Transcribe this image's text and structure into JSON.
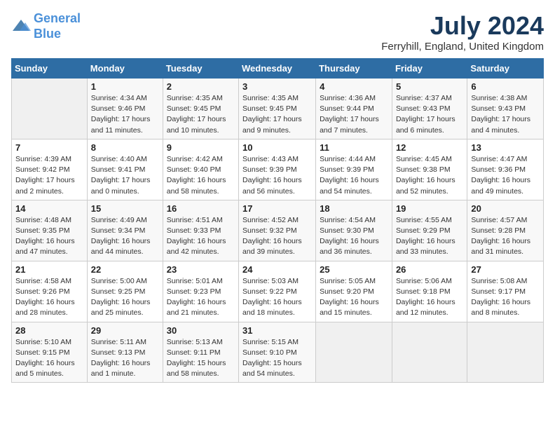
{
  "header": {
    "logo_line1": "General",
    "logo_line2": "Blue",
    "month_title": "July 2024",
    "location": "Ferryhill, England, United Kingdom"
  },
  "weekdays": [
    "Sunday",
    "Monday",
    "Tuesday",
    "Wednesday",
    "Thursday",
    "Friday",
    "Saturday"
  ],
  "weeks": [
    [
      {
        "day": "",
        "empty": true
      },
      {
        "day": "1",
        "sunrise": "Sunrise: 4:34 AM",
        "sunset": "Sunset: 9:46 PM",
        "daylight": "Daylight: 17 hours and 11 minutes."
      },
      {
        "day": "2",
        "sunrise": "Sunrise: 4:35 AM",
        "sunset": "Sunset: 9:45 PM",
        "daylight": "Daylight: 17 hours and 10 minutes."
      },
      {
        "day": "3",
        "sunrise": "Sunrise: 4:35 AM",
        "sunset": "Sunset: 9:45 PM",
        "daylight": "Daylight: 17 hours and 9 minutes."
      },
      {
        "day": "4",
        "sunrise": "Sunrise: 4:36 AM",
        "sunset": "Sunset: 9:44 PM",
        "daylight": "Daylight: 17 hours and 7 minutes."
      },
      {
        "day": "5",
        "sunrise": "Sunrise: 4:37 AM",
        "sunset": "Sunset: 9:43 PM",
        "daylight": "Daylight: 17 hours and 6 minutes."
      },
      {
        "day": "6",
        "sunrise": "Sunrise: 4:38 AM",
        "sunset": "Sunset: 9:43 PM",
        "daylight": "Daylight: 17 hours and 4 minutes."
      }
    ],
    [
      {
        "day": "7",
        "sunrise": "Sunrise: 4:39 AM",
        "sunset": "Sunset: 9:42 PM",
        "daylight": "Daylight: 17 hours and 2 minutes."
      },
      {
        "day": "8",
        "sunrise": "Sunrise: 4:40 AM",
        "sunset": "Sunset: 9:41 PM",
        "daylight": "Daylight: 17 hours and 0 minutes."
      },
      {
        "day": "9",
        "sunrise": "Sunrise: 4:42 AM",
        "sunset": "Sunset: 9:40 PM",
        "daylight": "Daylight: 16 hours and 58 minutes."
      },
      {
        "day": "10",
        "sunrise": "Sunrise: 4:43 AM",
        "sunset": "Sunset: 9:39 PM",
        "daylight": "Daylight: 16 hours and 56 minutes."
      },
      {
        "day": "11",
        "sunrise": "Sunrise: 4:44 AM",
        "sunset": "Sunset: 9:39 PM",
        "daylight": "Daylight: 16 hours and 54 minutes."
      },
      {
        "day": "12",
        "sunrise": "Sunrise: 4:45 AM",
        "sunset": "Sunset: 9:38 PM",
        "daylight": "Daylight: 16 hours and 52 minutes."
      },
      {
        "day": "13",
        "sunrise": "Sunrise: 4:47 AM",
        "sunset": "Sunset: 9:36 PM",
        "daylight": "Daylight: 16 hours and 49 minutes."
      }
    ],
    [
      {
        "day": "14",
        "sunrise": "Sunrise: 4:48 AM",
        "sunset": "Sunset: 9:35 PM",
        "daylight": "Daylight: 16 hours and 47 minutes."
      },
      {
        "day": "15",
        "sunrise": "Sunrise: 4:49 AM",
        "sunset": "Sunset: 9:34 PM",
        "daylight": "Daylight: 16 hours and 44 minutes."
      },
      {
        "day": "16",
        "sunrise": "Sunrise: 4:51 AM",
        "sunset": "Sunset: 9:33 PM",
        "daylight": "Daylight: 16 hours and 42 minutes."
      },
      {
        "day": "17",
        "sunrise": "Sunrise: 4:52 AM",
        "sunset": "Sunset: 9:32 PM",
        "daylight": "Daylight: 16 hours and 39 minutes."
      },
      {
        "day": "18",
        "sunrise": "Sunrise: 4:54 AM",
        "sunset": "Sunset: 9:30 PM",
        "daylight": "Daylight: 16 hours and 36 minutes."
      },
      {
        "day": "19",
        "sunrise": "Sunrise: 4:55 AM",
        "sunset": "Sunset: 9:29 PM",
        "daylight": "Daylight: 16 hours and 33 minutes."
      },
      {
        "day": "20",
        "sunrise": "Sunrise: 4:57 AM",
        "sunset": "Sunset: 9:28 PM",
        "daylight": "Daylight: 16 hours and 31 minutes."
      }
    ],
    [
      {
        "day": "21",
        "sunrise": "Sunrise: 4:58 AM",
        "sunset": "Sunset: 9:26 PM",
        "daylight": "Daylight: 16 hours and 28 minutes."
      },
      {
        "day": "22",
        "sunrise": "Sunrise: 5:00 AM",
        "sunset": "Sunset: 9:25 PM",
        "daylight": "Daylight: 16 hours and 25 minutes."
      },
      {
        "day": "23",
        "sunrise": "Sunrise: 5:01 AM",
        "sunset": "Sunset: 9:23 PM",
        "daylight": "Daylight: 16 hours and 21 minutes."
      },
      {
        "day": "24",
        "sunrise": "Sunrise: 5:03 AM",
        "sunset": "Sunset: 9:22 PM",
        "daylight": "Daylight: 16 hours and 18 minutes."
      },
      {
        "day": "25",
        "sunrise": "Sunrise: 5:05 AM",
        "sunset": "Sunset: 9:20 PM",
        "daylight": "Daylight: 16 hours and 15 minutes."
      },
      {
        "day": "26",
        "sunrise": "Sunrise: 5:06 AM",
        "sunset": "Sunset: 9:18 PM",
        "daylight": "Daylight: 16 hours and 12 minutes."
      },
      {
        "day": "27",
        "sunrise": "Sunrise: 5:08 AM",
        "sunset": "Sunset: 9:17 PM",
        "daylight": "Daylight: 16 hours and 8 minutes."
      }
    ],
    [
      {
        "day": "28",
        "sunrise": "Sunrise: 5:10 AM",
        "sunset": "Sunset: 9:15 PM",
        "daylight": "Daylight: 16 hours and 5 minutes."
      },
      {
        "day": "29",
        "sunrise": "Sunrise: 5:11 AM",
        "sunset": "Sunset: 9:13 PM",
        "daylight": "Daylight: 16 hours and 1 minute."
      },
      {
        "day": "30",
        "sunrise": "Sunrise: 5:13 AM",
        "sunset": "Sunset: 9:11 PM",
        "daylight": "Daylight: 15 hours and 58 minutes."
      },
      {
        "day": "31",
        "sunrise": "Sunrise: 5:15 AM",
        "sunset": "Sunset: 9:10 PM",
        "daylight": "Daylight: 15 hours and 54 minutes."
      },
      {
        "day": "",
        "empty": true
      },
      {
        "day": "",
        "empty": true
      },
      {
        "day": "",
        "empty": true
      }
    ]
  ]
}
